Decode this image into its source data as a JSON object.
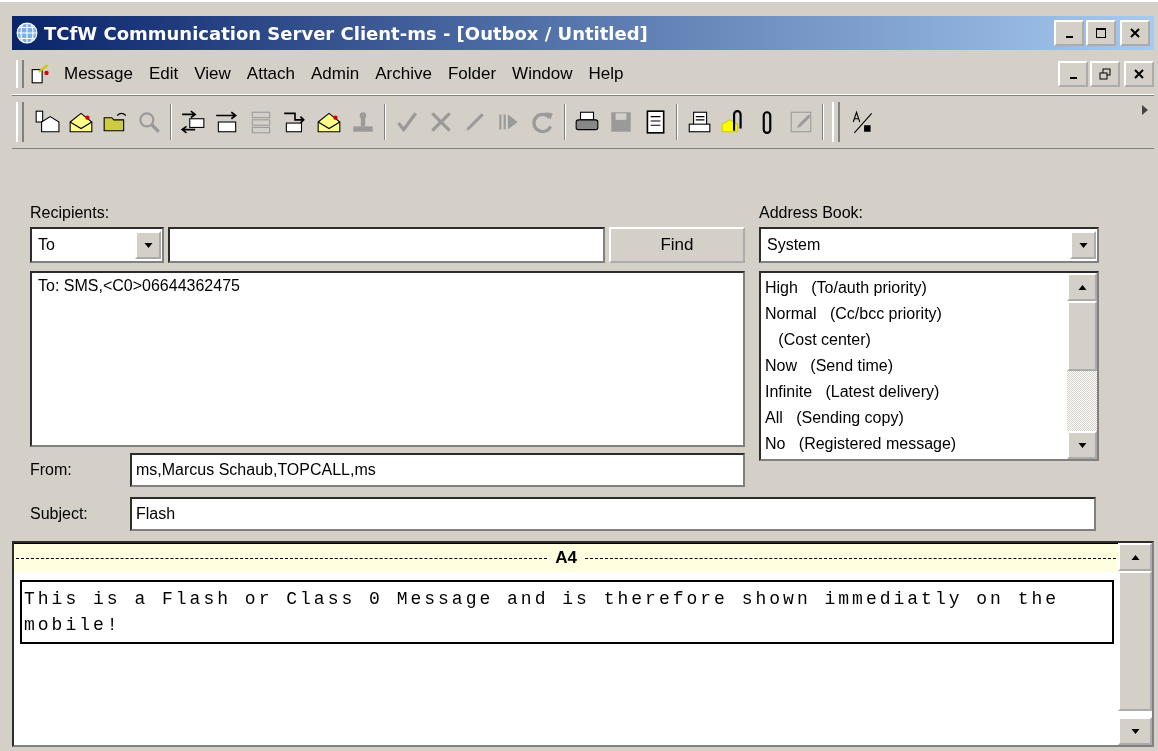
{
  "window": {
    "title": "TCfW Communication Server Client-ms - [Outbox / Untitled]"
  },
  "menu": [
    "Message",
    "Edit",
    "View",
    "Attach",
    "Admin",
    "Archive",
    "Folder",
    "Window",
    "Help"
  ],
  "toolbar": [
    {
      "kind": "new",
      "disabled": false
    },
    {
      "kind": "compose",
      "disabled": false
    },
    {
      "kind": "open",
      "disabled": false
    },
    {
      "kind": "find",
      "disabled": true
    },
    {
      "kind": "sep"
    },
    {
      "kind": "exchange",
      "disabled": false
    },
    {
      "kind": "send",
      "disabled": false
    },
    {
      "kind": "queue",
      "disabled": true
    },
    {
      "kind": "forward",
      "disabled": false
    },
    {
      "kind": "compose",
      "disabled": false
    },
    {
      "kind": "stamp",
      "disabled": true
    },
    {
      "kind": "sep"
    },
    {
      "kind": "check",
      "disabled": true
    },
    {
      "kind": "cross",
      "disabled": true
    },
    {
      "kind": "pen",
      "disabled": true
    },
    {
      "kind": "play",
      "disabled": true
    },
    {
      "kind": "refresh",
      "disabled": true
    },
    {
      "kind": "sep"
    },
    {
      "kind": "print",
      "disabled": false
    },
    {
      "kind": "save",
      "disabled": true
    },
    {
      "kind": "notebook",
      "disabled": false
    },
    {
      "kind": "sep"
    },
    {
      "kind": "fax",
      "disabled": false
    },
    {
      "kind": "clipnote",
      "disabled": false
    },
    {
      "kind": "clip",
      "disabled": false
    },
    {
      "kind": "edit",
      "disabled": true
    }
  ],
  "form": {
    "recipients_label": "Recipients:",
    "type_select": "To",
    "find_button": "Find",
    "recipients_list": "To: SMS,<C0>06644362475",
    "from_label": "From:",
    "from_value": "ms,Marcus Schaub,TOPCALL,ms",
    "subject_label": "Subject:",
    "subject_value": "Flash"
  },
  "address_book": {
    "label": "Address Book:",
    "value": "System",
    "options": [
      {
        "value": "High",
        "note": "(To/auth priority)"
      },
      {
        "value": "Normal",
        "note": "(Cc/bcc priority)"
      },
      {
        "note": "(Cost center)"
      },
      {
        "value": "Now",
        "note": "(Send time)"
      },
      {
        "value": "Infinite",
        "note": "(Latest delivery)"
      },
      {
        "value": "All",
        "note": "(Sending copy)"
      },
      {
        "value": "No",
        "note": "(Registered message)"
      }
    ]
  },
  "editor": {
    "page_label": "A4",
    "body": "This is a Flash or Class 0 Message and is therefore shown immediatly on the mobile!"
  }
}
